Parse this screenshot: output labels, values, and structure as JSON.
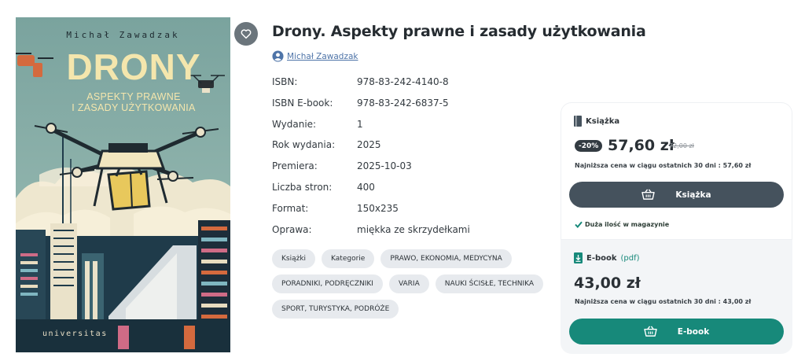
{
  "cover": {
    "author": "Michał Zawadzak",
    "title": "DRONY",
    "subtitle_line1": "ASPEKTY PRAWNE",
    "subtitle_line2": "I ZASADY UŻYTKOWANIA",
    "publisher": "universitas"
  },
  "favorite": {
    "icon": "heart-icon"
  },
  "book": {
    "title": "Drony. Aspekty prawne i zasady użytkowania",
    "author_icon": "user-icon",
    "author": "Michał Zawadzak"
  },
  "specs": [
    {
      "label": "ISBN:",
      "value": "978-83-242-4140-8"
    },
    {
      "label": "ISBN E-book:",
      "value": "978-83-242-6837-5"
    },
    {
      "label": "Wydanie:",
      "value": "1"
    },
    {
      "label": "Rok wydania:",
      "value": "2025"
    },
    {
      "label": "Premiera:",
      "value": "2025-10-03"
    },
    {
      "label": "Liczba stron:",
      "value": "400"
    },
    {
      "label": "Format:",
      "value": "150x235"
    },
    {
      "label": "Oprawa:",
      "value": "miękka ze skrzydełkami"
    }
  ],
  "tags": [
    "Książki",
    "Kategorie",
    "PRAWO, EKONOMIA, MEDYCYNA",
    "PORADNIKI, PODRĘCZNIKI",
    "VARIA",
    "NAUKI ŚCISŁE, TECHNIKA",
    "SPORT, TURYSTYKA, PODRÓŻE"
  ],
  "purchase": {
    "book": {
      "icon": "book-icon",
      "label": "Książka",
      "discount": "-20%",
      "price": "57,60 zł",
      "old_price": "72,00 zł",
      "lowest_label": "Najniższa cena w ciągu ostatnich 30 dni :",
      "lowest_value": "57,60 zł",
      "button_icon": "basket-icon",
      "button_label": "Książka",
      "stock_icon": "check-icon",
      "stock": "Duża ilość w magazynie"
    },
    "ebook": {
      "icon": "download-file-icon",
      "label": "E-book",
      "format": "(pdf)",
      "price": "43,00 zł",
      "lowest_label": "Najniższa cena w ciągu ostatnich 30 dni :",
      "lowest_value": "43,00 zł",
      "button_icon": "basket-icon",
      "button_label": "E-book"
    }
  },
  "colors": {
    "accent_dark": "#45525d",
    "accent_green": "#17897a",
    "link": "#4e74a8"
  }
}
